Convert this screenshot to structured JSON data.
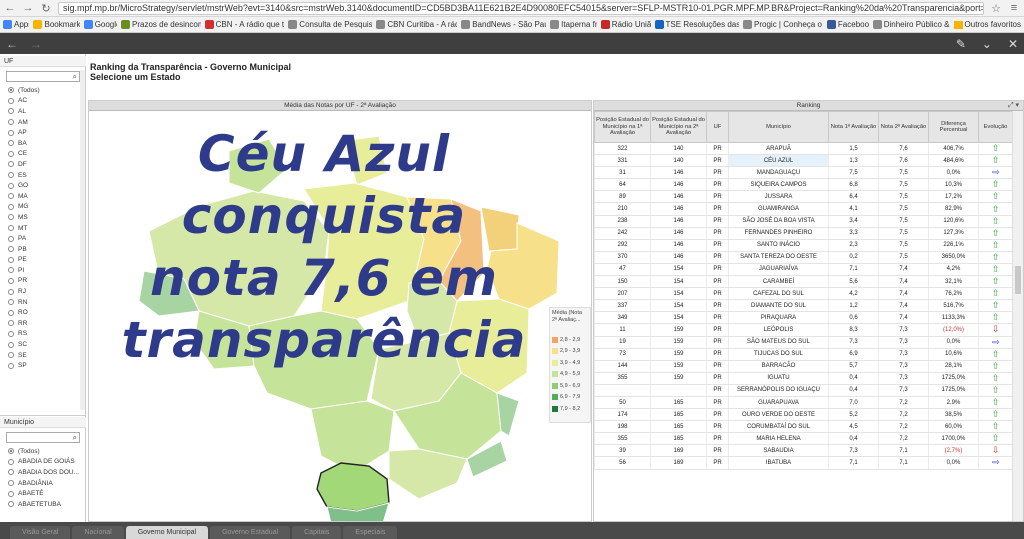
{
  "browser": {
    "url": "sig.mpf.mp.br/MicroStrategy/servlet/mstrWeb?evt=3140&src=mstrWeb.3140&documentID=CD5BD3BA11E621B2E4D90080EFC54015&server=SFLP-MSTR10-01.PGR.MPF.MP.BR&Project=Ranking%20da%20Transparencia&port=0&share=1",
    "bookmarks": [
      {
        "label": "Apps",
        "color": "#4285f4"
      },
      {
        "label": "Bookmarks",
        "color": "#f4b400"
      },
      {
        "label": "Google",
        "color": "#4285f4"
      },
      {
        "label": "Prazos de desincomp",
        "color": "#6b8e23"
      },
      {
        "label": "CBN - A rádio que toc",
        "color": "#d32f2f"
      },
      {
        "label": "Consulta de Pesquisas",
        "color": "#888888"
      },
      {
        "label": "CBN Curitiba - A rádio",
        "color": "#888888"
      },
      {
        "label": "BandNews - São Paulo",
        "color": "#888888"
      },
      {
        "label": "Itaperna fm",
        "color": "#888888"
      },
      {
        "label": "Rádio União",
        "color": "#c62828"
      },
      {
        "label": "TSE Resoluções das E",
        "color": "#1565c0"
      },
      {
        "label": "Progic | Conheça o Si",
        "color": "#888888"
      },
      {
        "label": "Facebook",
        "color": "#3b5998"
      },
      {
        "label": "Dinheiro Público & C",
        "color": "#888888"
      }
    ],
    "other_bookmarks": "Outros favoritos"
  },
  "uf_panel": {
    "title": "UF",
    "options": [
      "(Todos)",
      "AC",
      "AL",
      "AM",
      "AP",
      "BA",
      "CE",
      "DF",
      "ES",
      "GO",
      "MA",
      "MG",
      "MS",
      "MT",
      "PA",
      "PB",
      "PE",
      "PI",
      "PR",
      "RJ",
      "RN",
      "RO",
      "RR",
      "RS",
      "SC",
      "SE",
      "SP"
    ]
  },
  "municipio_panel": {
    "title": "Município",
    "options": [
      "(Todos)",
      "ABADIA DE GOIÁS",
      "ABADIA DOS DOU...",
      "ABADIÂNIA",
      "ABAETÉ",
      "ABAETETUBA"
    ]
  },
  "heading": {
    "line1": "Ranking da Transparência - Governo Municipal",
    "line2": "Selecione um Estado"
  },
  "map_section": {
    "title": "Média das Notas por UF - 2ª Avaliação",
    "overlay_lines": [
      "Céu Azul",
      "conquista",
      "nota 7,6 em",
      "transparência"
    ],
    "legend_title": "Média (Nota 2ª Avaliaç...",
    "legend": [
      {
        "label": "2,8 - 2,9",
        "color": "#f4a460"
      },
      {
        "label": "2,9 - 3,9",
        "color": "#f6e08a"
      },
      {
        "label": "3,9 - 4,9",
        "color": "#e8ed9a"
      },
      {
        "label": "4,9 - 5,9",
        "color": "#c6e39a"
      },
      {
        "label": "5,9 - 6,9",
        "color": "#8fcd72"
      },
      {
        "label": "6,9 - 7,9",
        "color": "#4fae5a"
      },
      {
        "label": "7,9 - 8,2",
        "color": "#1e7a3c"
      }
    ]
  },
  "ranking": {
    "title": "Ranking",
    "columns": [
      "Posição Estadual do Município na 1ª Avaliação",
      "Posição Estadual do Município na 2ª Avaliação",
      "UF",
      "Município",
      "Nota 1ª Avaliação",
      "Nota 2ª Avaliação",
      "Diferença Percentual",
      "Evolução"
    ],
    "rows": [
      {
        "p1": "322",
        "p2": "140",
        "uf": "PR",
        "mun": "ARAPUÃ",
        "n1": "1,5",
        "n2": "7,6",
        "dif": "406,7%",
        "ev": "up"
      },
      {
        "p1": "331",
        "p2": "140",
        "uf": "PR",
        "mun": "CÉU AZUL",
        "n1": "1,3",
        "n2": "7,6",
        "dif": "484,6%",
        "ev": "up",
        "hl": true
      },
      {
        "p1": "31",
        "p2": "146",
        "uf": "PR",
        "mun": "MANDAGUAÇU",
        "n1": "7,5",
        "n2": "7,5",
        "dif": "0,0%",
        "ev": "eq"
      },
      {
        "p1": "64",
        "p2": "146",
        "uf": "PR",
        "mun": "SIQUEIRA CAMPOS",
        "n1": "6,8",
        "n2": "7,5",
        "dif": "10,3%",
        "ev": "up"
      },
      {
        "p1": "89",
        "p2": "146",
        "uf": "PR",
        "mun": "JUSSARA",
        "n1": "6,4",
        "n2": "7,5",
        "dif": "17,2%",
        "ev": "up"
      },
      {
        "p1": "210",
        "p2": "146",
        "uf": "PR",
        "mun": "GUAMIRANGA",
        "n1": "4,1",
        "n2": "7,5",
        "dif": "82,9%",
        "ev": "up"
      },
      {
        "p1": "238",
        "p2": "146",
        "uf": "PR",
        "mun": "SÃO JOSÉ DA BOA VISTA",
        "n1": "3,4",
        "n2": "7,5",
        "dif": "120,6%",
        "ev": "up"
      },
      {
        "p1": "242",
        "p2": "146",
        "uf": "PR",
        "mun": "FERNANDES PINHEIRO",
        "n1": "3,3",
        "n2": "7,5",
        "dif": "127,3%",
        "ev": "up"
      },
      {
        "p1": "292",
        "p2": "146",
        "uf": "PR",
        "mun": "SANTO INÁCIO",
        "n1": "2,3",
        "n2": "7,5",
        "dif": "226,1%",
        "ev": "up"
      },
      {
        "p1": "370",
        "p2": "146",
        "uf": "PR",
        "mun": "SANTA TEREZA DO OESTE",
        "n1": "0,2",
        "n2": "7,5",
        "dif": "3650,0%",
        "ev": "up"
      },
      {
        "p1": "47",
        "p2": "154",
        "uf": "PR",
        "mun": "JAGUARIAÍVA",
        "n1": "7,1",
        "n2": "7,4",
        "dif": "4,2%",
        "ev": "up"
      },
      {
        "p1": "150",
        "p2": "154",
        "uf": "PR",
        "mun": "CARAMBEÍ",
        "n1": "5,6",
        "n2": "7,4",
        "dif": "32,1%",
        "ev": "up"
      },
      {
        "p1": "207",
        "p2": "154",
        "uf": "PR",
        "mun": "CAFEZAL DO SUL",
        "n1": "4,2",
        "n2": "7,4",
        "dif": "76,2%",
        "ev": "up"
      },
      {
        "p1": "337",
        "p2": "154",
        "uf": "PR",
        "mun": "DIAMANTE DO SUL",
        "n1": "1,2",
        "n2": "7,4",
        "dif": "516,7%",
        "ev": "up"
      },
      {
        "p1": "349",
        "p2": "154",
        "uf": "PR",
        "mun": "PIRAQUARA",
        "n1": "0,6",
        "n2": "7,4",
        "dif": "1133,3%",
        "ev": "up"
      },
      {
        "p1": "11",
        "p2": "159",
        "uf": "PR",
        "mun": "LEÓPOLIS",
        "n1": "8,3",
        "n2": "7,3",
        "dif": "(12,0%)",
        "ev": "dn",
        "neg": true
      },
      {
        "p1": "19",
        "p2": "159",
        "uf": "PR",
        "mun": "SÃO MATEUS DO SUL",
        "n1": "7,3",
        "n2": "7,3",
        "dif": "0,0%",
        "ev": "eq"
      },
      {
        "p1": "73",
        "p2": "159",
        "uf": "PR",
        "mun": "TIJUCAS DO SUL",
        "n1": "6,9",
        "n2": "7,3",
        "dif": "10,6%",
        "ev": "up"
      },
      {
        "p1": "144",
        "p2": "159",
        "uf": "PR",
        "mun": "BARRACÃO",
        "n1": "5,7",
        "n2": "7,3",
        "dif": "28,1%",
        "ev": "up"
      },
      {
        "p1": "355",
        "p2": "159",
        "uf": "PR",
        "mun": "IGUATU",
        "n1": "0,4",
        "n2": "7,3",
        "dif": "1725,0%",
        "ev": "up"
      },
      {
        "p1": "",
        "p2": "",
        "uf": "PR",
        "mun": "SERRANÓPOLIS DO IGUAÇU",
        "n1": "0,4",
        "n2": "7,3",
        "dif": "1725,0%",
        "ev": "up"
      },
      {
        "p1": "50",
        "p2": "165",
        "uf": "PR",
        "mun": "GUARAPUAVA",
        "n1": "7,0",
        "n2": "7,2",
        "dif": "2,9%",
        "ev": "up"
      },
      {
        "p1": "174",
        "p2": "165",
        "uf": "PR",
        "mun": "OURO VERDE DO OESTE",
        "n1": "5,2",
        "n2": "7,2",
        "dif": "38,5%",
        "ev": "up"
      },
      {
        "p1": "198",
        "p2": "165",
        "uf": "PR",
        "mun": "CORUMBATAÍ DO SUL",
        "n1": "4,5",
        "n2": "7,2",
        "dif": "60,0%",
        "ev": "up"
      },
      {
        "p1": "355",
        "p2": "165",
        "uf": "PR",
        "mun": "MARIA HELENA",
        "n1": "0,4",
        "n2": "7,2",
        "dif": "1700,0%",
        "ev": "up"
      },
      {
        "p1": "39",
        "p2": "169",
        "uf": "PR",
        "mun": "SABAUDIA",
        "n1": "7,3",
        "n2": "7,1",
        "dif": "(2,7%)",
        "ev": "dn",
        "neg": true
      },
      {
        "p1": "56",
        "p2": "169",
        "uf": "PR",
        "mun": "IBATUBA",
        "n1": "7,1",
        "n2": "7,1",
        "dif": "0,0%",
        "ev": "eq"
      }
    ]
  },
  "bottom_tabs": [
    "Visão Geral",
    "Nacional",
    "Governo Municipal",
    "Governo Estadual",
    "Capitais",
    "Especiais"
  ],
  "active_tab": "Governo Municipal"
}
